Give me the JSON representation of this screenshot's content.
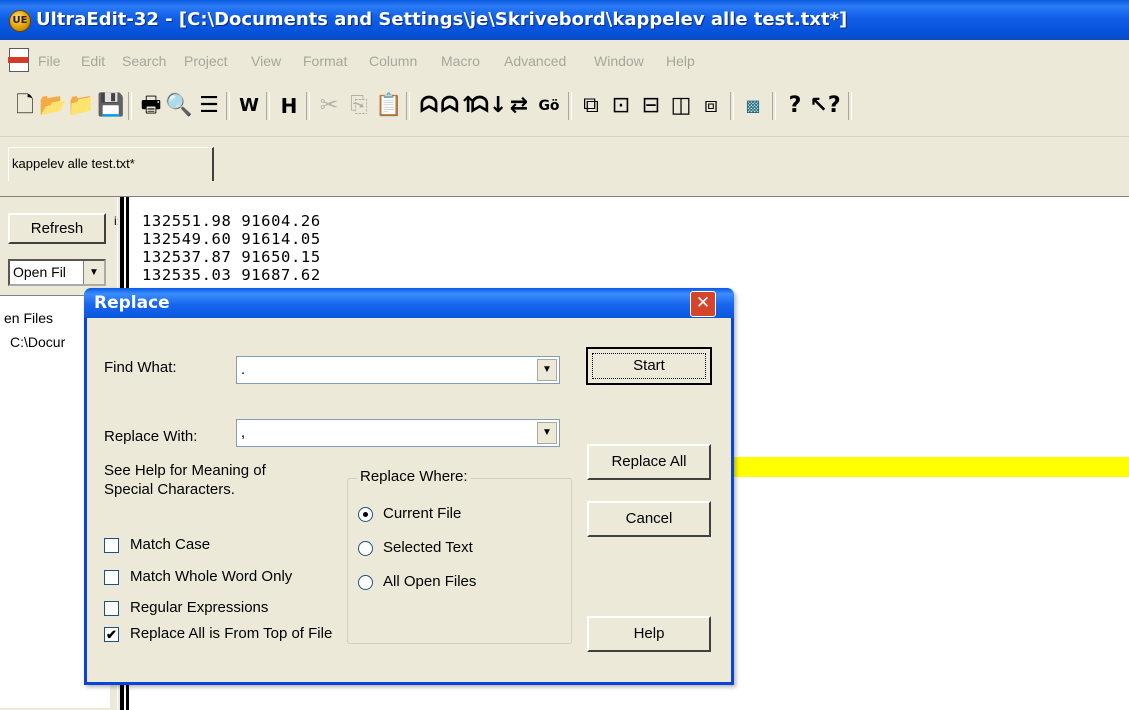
{
  "window": {
    "app_icon_text": "UE",
    "title": "UltraEdit-32 - [C:\\Documents and Settings\\je\\Skrivebord\\kappelev alle test.txt*]"
  },
  "menu": {
    "items": [
      "File",
      "Edit",
      "Search",
      "Project",
      "View",
      "Format",
      "Column",
      "Macro",
      "Advanced",
      "Window",
      "Help"
    ]
  },
  "toolbar": {
    "icons": [
      "new",
      "open",
      "open-folder",
      "save",
      "print",
      "print-preview",
      "page-setup",
      "word-wrap",
      "hex",
      "cut",
      "copy",
      "paste",
      "find",
      "find-next",
      "find-prev",
      "replace",
      "goto",
      "window-cascade",
      "window-tile",
      "split-horizontal",
      "split-vertical",
      "window-new",
      "color",
      "help",
      "whats-this"
    ],
    "wrap_label": "W",
    "hex_label": "H",
    "find_text": "Gö"
  },
  "tabs": [
    {
      "label": "kappelev alle test.txt*"
    }
  ],
  "left_pane": {
    "refresh_label": "Refresh",
    "open_select": "Open Fil",
    "files_header": "en Files",
    "files_item": "C:\\Docur",
    "label_fragment": "i:"
  },
  "editor": {
    "lines": [
      "132551.98 91604.26",
      "132549.60 91614.05",
      "132537.87 91650.15",
      "132535.03 91687.62"
    ]
  },
  "dialog": {
    "title": "Replace",
    "close_label": "✕",
    "find_label": "Find What:",
    "find_value": ".",
    "replace_label": "Replace With:",
    "replace_value": ",",
    "help_text_1": "See Help for Meaning of",
    "help_text_2": "Special Characters.",
    "options": [
      {
        "label": "Match Case",
        "checked": false
      },
      {
        "label": "Match Whole Word Only",
        "checked": false
      },
      {
        "label": "Regular Expressions",
        "checked": false
      },
      {
        "label": "Replace All is From Top of File",
        "checked": true
      }
    ],
    "replace_where": {
      "title": "Replace Where:",
      "choices": [
        {
          "label": "Current File",
          "selected": true
        },
        {
          "label": "Selected Text",
          "selected": false
        },
        {
          "label": "All Open Files",
          "selected": false
        }
      ]
    },
    "buttons": {
      "start": "Start",
      "replace_all": "Replace All",
      "cancel": "Cancel",
      "help": "Help"
    }
  },
  "colors": {
    "titlebar": "#0a5be0",
    "highlight": "#ffff00",
    "chrome": "#ece9d8",
    "close": "#d5452c"
  }
}
